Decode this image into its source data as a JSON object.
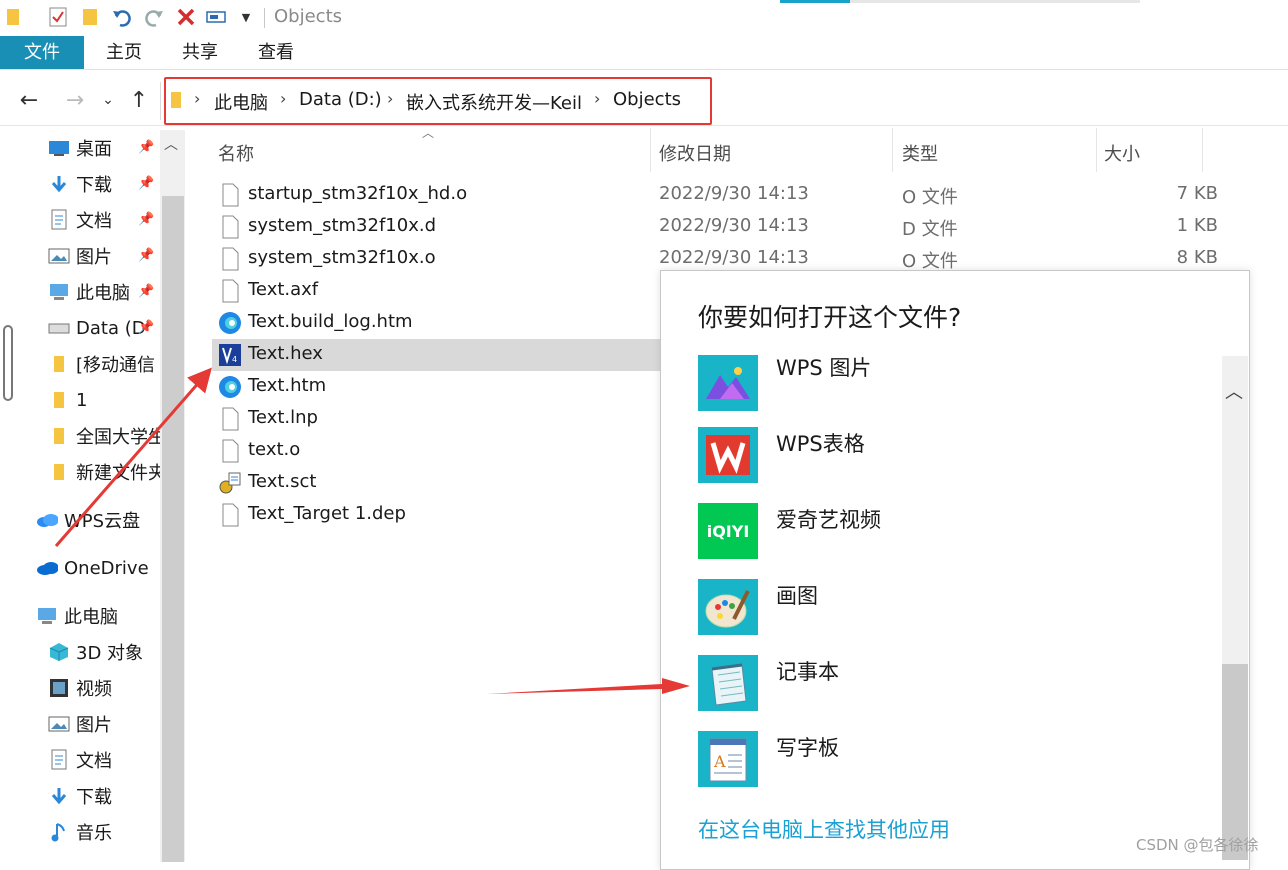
{
  "quick_access": {
    "title": "Objects",
    "icons": [
      "folder-icon",
      "properties-check-icon",
      "new-folder-icon",
      "undo-icon",
      "redo-icon",
      "delete-icon",
      "rename-icon",
      "customize-dropdown-icon"
    ]
  },
  "ribbon": {
    "tabs": [
      "文件",
      "主页",
      "共享",
      "查看"
    ]
  },
  "address_bar": {
    "crumbs": [
      "此电脑",
      "Data (D:)",
      "嵌入式系统开发—Keil",
      "Objects"
    ]
  },
  "nav_pane": {
    "quick_items": [
      {
        "label": "桌面",
        "icon": "desktop-icon"
      },
      {
        "label": "下载",
        "icon": "download-icon"
      },
      {
        "label": "文档",
        "icon": "document-icon"
      },
      {
        "label": "图片",
        "icon": "pictures-icon"
      },
      {
        "label": "此电脑",
        "icon": "computer-icon"
      },
      {
        "label": "Data (D",
        "icon": "drive-icon"
      },
      {
        "label": "[移动通信",
        "icon": "folder-icon"
      },
      {
        "label": "1",
        "icon": "folder-icon"
      },
      {
        "label": "全国大学生",
        "icon": "folder-icon"
      },
      {
        "label": "新建文件夹",
        "icon": "folder-icon"
      }
    ],
    "wps_cloud": "WPS云盘",
    "onedrive": "OneDrive",
    "this_pc": "此电脑",
    "pc_items": [
      {
        "label": "3D 对象",
        "icon": "3d-objects-icon"
      },
      {
        "label": "视频",
        "icon": "video-icon"
      },
      {
        "label": "图片",
        "icon": "pictures-icon"
      },
      {
        "label": "文档",
        "icon": "document-icon"
      },
      {
        "label": "下载",
        "icon": "download-icon"
      },
      {
        "label": "音乐",
        "icon": "music-icon"
      }
    ]
  },
  "file_list": {
    "headers": {
      "name": "名称",
      "date": "修改日期",
      "type": "类型",
      "size": "大小"
    },
    "files": [
      {
        "name": "startup_stm32f10x_hd.o",
        "date": "2022/9/30 14:13",
        "type": "O 文件",
        "size": "7 KB",
        "icon": "file-icon"
      },
      {
        "name": "system_stm32f10x.d",
        "date": "2022/9/30 14:13",
        "type": "D 文件",
        "size": "1 KB",
        "icon": "file-icon"
      },
      {
        "name": "system_stm32f10x.o",
        "date": "2022/9/30 14:13",
        "type": "O 文件",
        "size": "8 KB",
        "icon": "file-icon"
      },
      {
        "name": "Text.axf",
        "icon": "file-icon"
      },
      {
        "name": "Text.build_log.htm",
        "icon": "edge-icon"
      },
      {
        "name": "Text.hex",
        "icon": "keil-icon",
        "selected": true
      },
      {
        "name": "Text.htm",
        "icon": "edge-icon"
      },
      {
        "name": "Text.lnp",
        "icon": "file-icon"
      },
      {
        "name": "text.o",
        "icon": "file-icon"
      },
      {
        "name": "Text.sct",
        "icon": "scatter-file-icon"
      },
      {
        "name": "Text_Target 1.dep",
        "icon": "file-icon"
      }
    ]
  },
  "open_with_dialog": {
    "title": "你要如何打开这个文件?",
    "apps": [
      {
        "label": "WPS 图片",
        "icon": "wps-picture-icon"
      },
      {
        "label": "WPS表格",
        "icon": "wps-spreadsheet-icon"
      },
      {
        "label": "爱奇艺视频",
        "icon": "iqiyi-icon",
        "icon_text": "iQIYI"
      },
      {
        "label": "画图",
        "icon": "paint-icon"
      },
      {
        "label": "记事本",
        "icon": "notepad-icon"
      },
      {
        "label": "写字板",
        "icon": "wordpad-icon"
      }
    ],
    "more_link": "在这台电脑上查找其他应用"
  },
  "watermark": "CSDN @包各徐徐",
  "colors": {
    "accent": "#1a8fb5",
    "annotation": "#e53935",
    "link": "#1ba1d4",
    "app_tile": "#1ab4c8"
  }
}
